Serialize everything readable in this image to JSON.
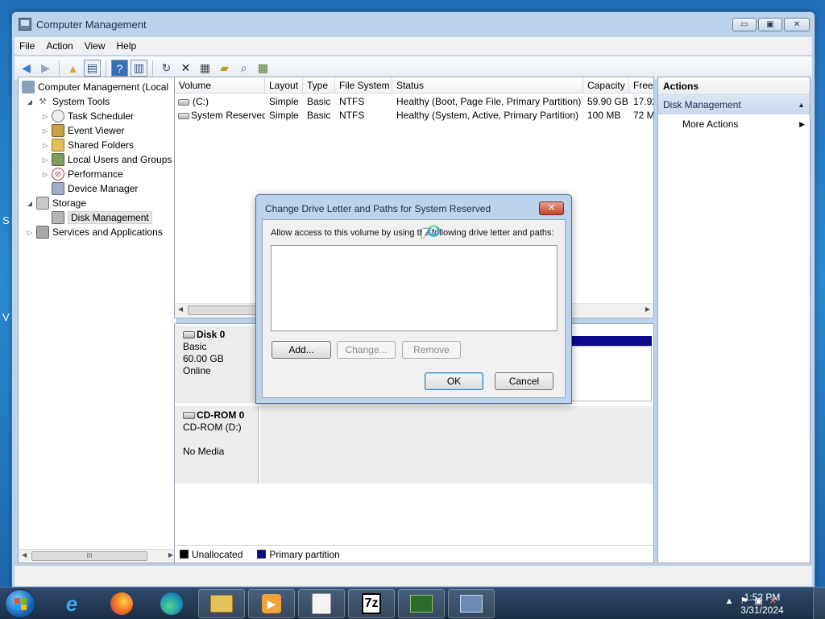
{
  "desktop": {
    "glyph_top": "S",
    "glyph_bottom": "V"
  },
  "window": {
    "title": "Computer Management",
    "controls": {
      "minimize": "▭",
      "maximize": "▣",
      "close": "✕"
    }
  },
  "menu": [
    "File",
    "Action",
    "View",
    "Help"
  ],
  "toolbar": {
    "icons": [
      "back-icon",
      "forward-icon",
      "up-folder-icon",
      "show-hide-tree-icon",
      "help-icon",
      "console-view-icon",
      "refresh-icon",
      "delete-icon",
      "properties-icon",
      "open-folder-icon",
      "search-icon",
      "export-icon"
    ]
  },
  "tree": {
    "root": "Computer Management (Local",
    "system_tools": "System Tools",
    "task_scheduler": "Task Scheduler",
    "event_viewer": "Event Viewer",
    "shared_folders": "Shared Folders",
    "local_users": "Local Users and Groups",
    "performance": "Performance",
    "device_manager": "Device Manager",
    "storage": "Storage",
    "disk_management": "Disk Management",
    "services": "Services and Applications",
    "scroll_thumb": "III"
  },
  "volumes": {
    "columns": [
      "Volume",
      "Layout",
      "Type",
      "File System",
      "Status",
      "Capacity",
      "Free"
    ],
    "rows": [
      {
        "volume": "(C:)",
        "layout": "Simple",
        "type": "Basic",
        "fs": "NTFS",
        "status": "Healthy (Boot, Page File, Primary Partition)",
        "capacity": "59.90 GB",
        "free": "17.92"
      },
      {
        "volume": "System Reserved",
        "layout": "Simple",
        "type": "Basic",
        "fs": "NTFS",
        "status": "Healthy (System, Active, Primary Partition)",
        "capacity": "100 MB",
        "free": "72 M"
      }
    ]
  },
  "disks": {
    "disk0": {
      "name": "Disk 0",
      "kind": "Basic",
      "size": "60.00 GB",
      "state": "Online"
    },
    "cdrom0": {
      "name": "CD-ROM 0",
      "kind": "CD-ROM (D:)",
      "state": "No Media"
    }
  },
  "legend": {
    "unallocated": "Unallocated",
    "primary": "Primary partition",
    "unallocated_color": "#000000",
    "primary_color": "#0a0a8a"
  },
  "actions": {
    "header": "Actions",
    "section": "Disk Management",
    "more": "More Actions"
  },
  "dialog": {
    "title": "Change Drive Letter and Paths for System Reserved",
    "close": "✕",
    "prompt": "Allow access to this volume by using the following drive letter and paths:",
    "add": "Add...",
    "change": "Change...",
    "remove": "Remove",
    "ok": "OK",
    "cancel": "Cancel"
  },
  "taskbar": {
    "apps": [
      "internet-explorer-icon",
      "firefox-icon",
      "edge-icon",
      "file-explorer-icon",
      "media-player-icon",
      "disc-icon",
      "7zip-icon",
      "task-manager-icon",
      "computer-management-icon"
    ],
    "seven_zip": "7z",
    "time": "1:52 PM",
    "date": "3/31/2024"
  },
  "colors": {
    "accent": "#2b8ad0",
    "title_bar": "#bcd3ee",
    "selection": "#c7d7ec"
  }
}
